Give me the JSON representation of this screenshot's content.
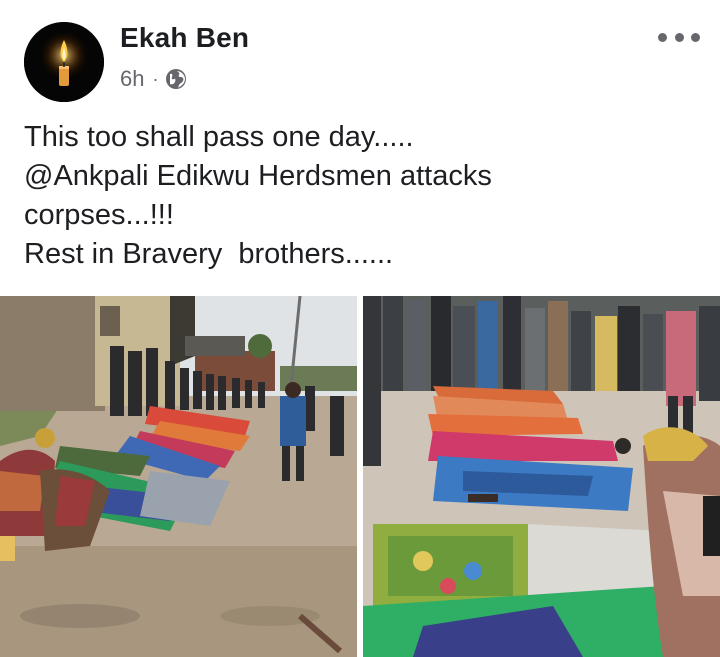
{
  "post": {
    "author": "Ekah Ben",
    "time": "6h",
    "separator": "·",
    "privacy_icon": "globe-icon",
    "more_icon": "more-options-icon",
    "text_lines": [
      "This too shall pass one day.....",
      "@Ankpali Edikwu Herdsmen attacks",
      "corpses...!!!",
      "Rest in Bravery  brothers......"
    ],
    "photos": [
      {
        "name": "photo-1"
      },
      {
        "name": "photo-2"
      }
    ]
  },
  "colors": {
    "author_text": "#1c1e21",
    "meta_text": "#65676b",
    "avatar_bg": "#050505",
    "flame": "#f5a623"
  }
}
